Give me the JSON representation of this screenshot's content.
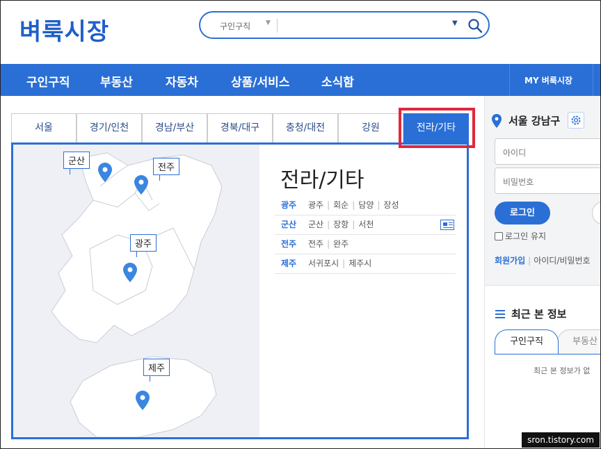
{
  "header": {
    "logo": "벼룩시장",
    "search": {
      "category": "구인구직"
    }
  },
  "nav": {
    "items": [
      "구인구직",
      "부동산",
      "자동차",
      "상품/서비스",
      "소식함"
    ],
    "my": "MY 벼룩시장"
  },
  "regions": {
    "tabs": [
      "서울",
      "경기/인천",
      "경남/부산",
      "경북/대구",
      "충청/대전",
      "강원",
      "전라/기타"
    ],
    "active_tab": "전라/기타",
    "title": "전라/기타",
    "rows": [
      {
        "city": "광주",
        "districts": [
          "광주",
          "회순",
          "담양",
          "장성"
        ]
      },
      {
        "city": "군산",
        "districts": [
          "군산",
          "장항",
          "서천"
        ]
      },
      {
        "city": "전주",
        "districts": [
          "전주",
          "완주"
        ]
      },
      {
        "city": "제주",
        "districts": [
          "서귀포시",
          "제주시"
        ]
      }
    ],
    "map_labels": {
      "gunsan": "군산",
      "jeonju": "전주",
      "gwangju": "광주",
      "jeju": "제주"
    }
  },
  "sidebar": {
    "location": "서울 강남구",
    "id_placeholder": "아이디",
    "pw_placeholder": "비밀번호",
    "login": "로그인",
    "keep_login": "로그인 유지",
    "join": "회원가입",
    "find": "아이디/비밀번호",
    "recent_title": "최근 본 정보",
    "recent_tabs": [
      "구인구직",
      "부동산"
    ],
    "empty": "최근 본 정보가 없"
  },
  "watermark": "sron.tistory.com",
  "colors": {
    "brand": "#2a6fd6",
    "logo": "#1f5fc8",
    "highlight": "#e0283c",
    "map_bg": "#eef0f5"
  }
}
